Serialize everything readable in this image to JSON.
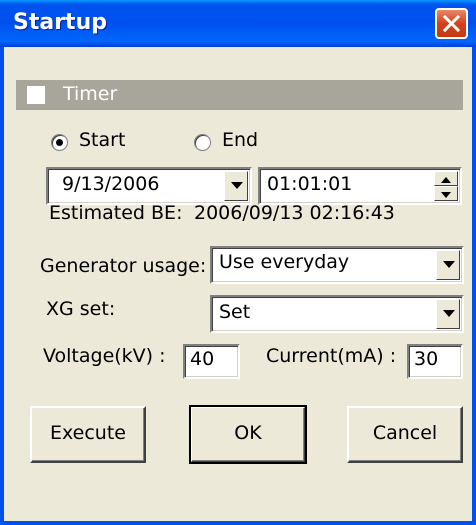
{
  "window": {
    "title": "Startup"
  },
  "timer": {
    "label": "Timer",
    "checked": false
  },
  "mode": {
    "start_label": "Start",
    "end_label": "End",
    "selected": "Start"
  },
  "date": {
    "value": "9/13/2006"
  },
  "time": {
    "value": "01:01:01"
  },
  "estimate": {
    "label": "Estimated BE:",
    "value": "2006/09/13 02:16:43"
  },
  "generator": {
    "label": "Generator usage:",
    "value": "Use everyday"
  },
  "xg": {
    "label": "XG set:",
    "value": "Set"
  },
  "voltage": {
    "label": "Voltage(kV) :",
    "value": "40"
  },
  "current": {
    "label": "Current(mA) :",
    "value": "30"
  },
  "buttons": {
    "execute": "Execute",
    "ok": "OK",
    "cancel": "Cancel"
  },
  "colors": {
    "titlebar": "#0054E3",
    "close": "#D5421D",
    "face": "#ECE9D8",
    "timerbar": "#A8A59B"
  }
}
